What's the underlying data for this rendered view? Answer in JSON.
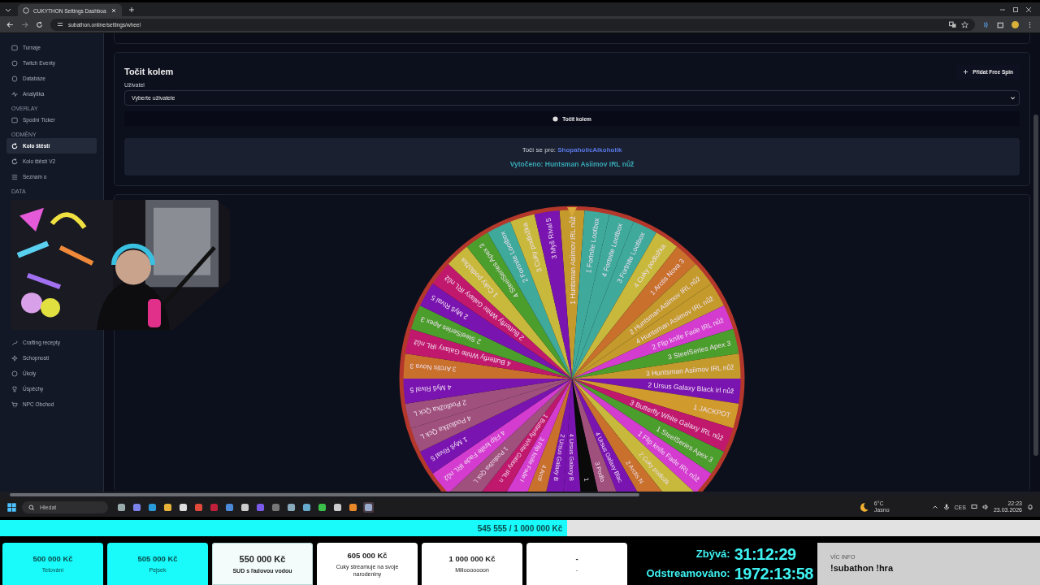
{
  "browser": {
    "tab_title": "CUKYTHON Settings Dashboa",
    "url": "subathon.online/settings/wheel"
  },
  "sidebar": {
    "sections": [
      {
        "items": [
          {
            "label": "Turnaje",
            "selected": false
          },
          {
            "label": "Twitch Eventy",
            "selected": false
          },
          {
            "label": "Databáze",
            "selected": false
          },
          {
            "label": "Analytika",
            "selected": false
          }
        ]
      },
      {
        "header": "OVERLAY",
        "items": [
          {
            "label": "Spodní Ticker",
            "selected": false
          }
        ]
      },
      {
        "header": "ODMĚNY",
        "items": [
          {
            "label": "Kolo štěstí",
            "selected": true
          },
          {
            "label": "Kolo štěstí V2",
            "selected": false
          },
          {
            "label": "Seznam o",
            "selected": false
          }
        ]
      },
      {
        "header": "DATA",
        "items": [
          {
            "label": "Crafting recepty",
            "selected": false
          },
          {
            "label": "Schopnosti",
            "selected": false
          },
          {
            "label": "Úkoly",
            "selected": false
          },
          {
            "label": "Úspěchy",
            "selected": false
          },
          {
            "label": "NPC Obchod",
            "selected": false
          }
        ]
      }
    ]
  },
  "spin_panel": {
    "title": "Točit kolem",
    "add_button": "Přidat Free Spin",
    "user_label": "Uživatel",
    "user_select": {
      "value": "Vyberte uživatele"
    },
    "spin_button": "Točit kolem",
    "spinning_for_label": "Točí se pro:",
    "spinning_for_user": "ShopaholicAlkoholik",
    "result": "Vytočeno: Huntsman Asiimov IRL nůž"
  },
  "wheel": {
    "segments": [
      "1 Huntsman Asiimov IRL nůž",
      "1 Fortnite Lootbox",
      "4 Fortnite Lootbox",
      "3 Fortnite Lootbox",
      "4 Cuky podložka",
      "1 Arctis Nova 3",
      "2 Huntsman Asiimov IRL nůž",
      "4 Huntsman Asiimov IRL nůž",
      "2 Flip knife Fade IRL nůž",
      "3 SteelSeries Apex 3",
      "3 Huntsman Asiimov IRL nůž",
      "2 Ursus Galaxy Black irl nůž",
      "1 JACKPOT",
      "3 Butterfly White Galaxy IRL nůž",
      "1 SteelSeries Apex 3",
      "1 Flip knife Fade IRL nůž",
      "2 Cuky podložk",
      "2 Arctis N",
      "4 Ursus Galaxy Blac",
      "3 Podlo",
      "1",
      "4 Ursus Galaxy B",
      "2 Ursus Galaxy B",
      "4 Arcti",
      "3 Flip knife Fade I",
      "1 Butterfly White Galaxy IRL n",
      "1 Podložka Qck L",
      "4 Flip knife Fade IRL nůž",
      "1 Myš Rival 5",
      "4 Podložka Qck L",
      "2 Podložka Qck L",
      "4 Myš Rival 5",
      "3 Arctis Nova 3",
      "4 Butterfly White Galaxy IRL nůž",
      "2 SteelSeries Apex 3",
      "2 Myš Rival 5",
      "2 Butterfly White Galaxy IRL nůž",
      "1 Cuky podložka",
      "4 SteelSeries Apex 3",
      "2 Fortnite Lootbox",
      "3 Cuky podložka",
      "3 Myš Rival 5"
    ]
  },
  "taskbar": {
    "search_placeholder": "Hledat",
    "weather_temp": "6°C",
    "weather_text": "Jasno",
    "language": "CES",
    "time": "22:23",
    "date": "23.03.2026"
  },
  "stream_overlay": {
    "progress": {
      "level": 0.545555,
      "text": "545 555 / 1 000 000 Kč"
    },
    "goals": [
      {
        "amount": "500 000 Kč",
        "label": "Tetování",
        "reached": true,
        "current": false
      },
      {
        "amount": "505 000 Kč",
        "label": "Pejsek",
        "reached": true,
        "current": false
      },
      {
        "amount": "550 000 Kč",
        "label": "SUD s ľadovou vodou",
        "reached": false,
        "current": true
      },
      {
        "amount": "605 000 Kč",
        "label": "Cuky streamuje na svoje narodeniny",
        "reached": false,
        "current": false
      },
      {
        "amount": "1 000 000 Kč",
        "label": "Miliooooooon",
        "reached": false,
        "current": false
      },
      {
        "amount": "-",
        "label": "-",
        "reached": false,
        "current": false
      }
    ],
    "timers": [
      {
        "label": "Zbývá:",
        "value": "31:12:29"
      },
      {
        "label": "Odstreamováno:",
        "value": "1972:13:58"
      }
    ],
    "info": {
      "heading": "VÍC INFO",
      "text": "!subathon !hra"
    }
  }
}
